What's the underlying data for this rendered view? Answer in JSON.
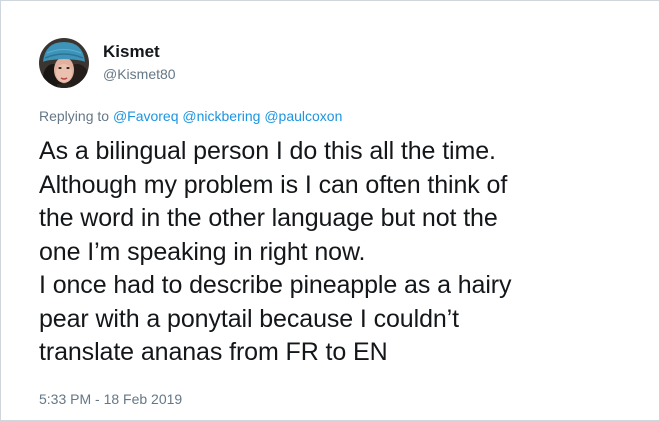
{
  "author": {
    "display_name": "Kismet",
    "handle": "@Kismet80"
  },
  "reply": {
    "prefix": "Replying to",
    "mentions": [
      "@Favoreq",
      "@nickbering",
      "@paulcoxon"
    ]
  },
  "tweet": {
    "lines": [
      "As a bilingual person I do this all the time.",
      "Although my problem is I can often think of",
      "the word in the other language but not the",
      "one I’m speaking in right now.",
      "I once had to describe pineapple as a hairy",
      "pear with a ponytail because I couldn’t",
      "translate ananas from FR to EN"
    ]
  },
  "timestamp": "5:33 PM - 18 Feb 2019",
  "colors": {
    "link": "#1b95e0",
    "secondary_text": "#657786",
    "primary_text": "#14171a",
    "border": "#cfd6dc",
    "avatar_hat": "#3d93b8"
  }
}
